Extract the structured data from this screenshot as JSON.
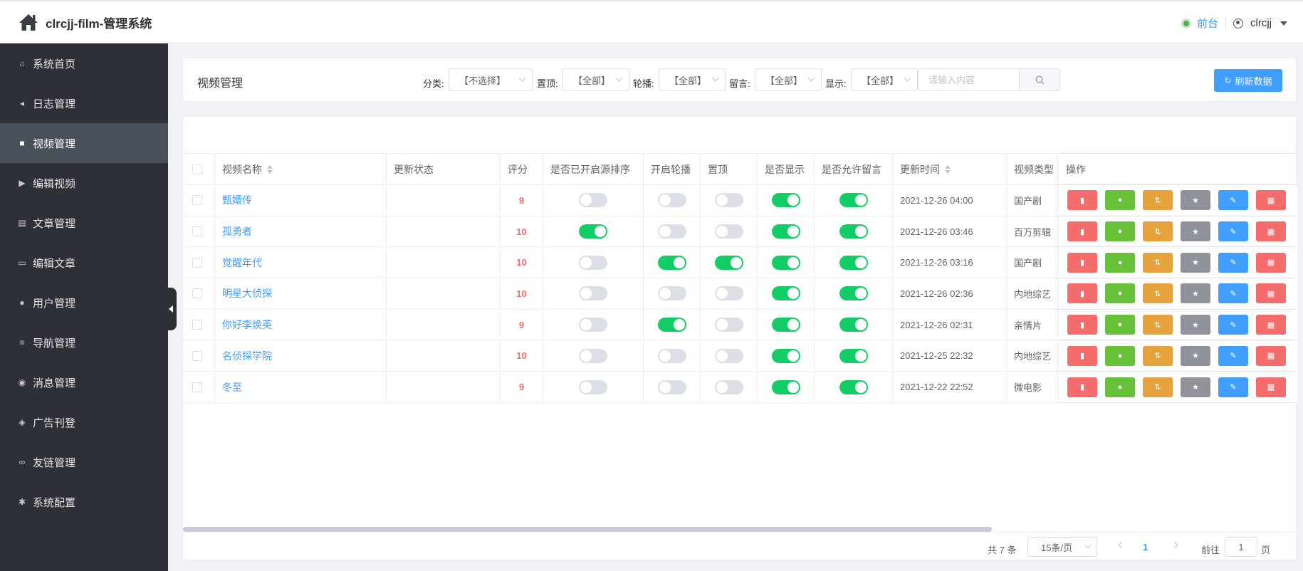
{
  "app": {
    "title": "clrcjj-film-管理系统"
  },
  "header": {
    "front_label": "前台",
    "username": "clrcjj"
  },
  "sidebar": {
    "items": [
      {
        "label": "系统首页",
        "icon": "home-icon",
        "glyph": "⌂"
      },
      {
        "label": "日志管理",
        "icon": "bullhorn-icon",
        "glyph": "◂"
      },
      {
        "label": "视频管理",
        "icon": "video-camera-icon",
        "glyph": "■",
        "active": true
      },
      {
        "label": "编辑视频",
        "icon": "youtube-play-icon",
        "glyph": "▶"
      },
      {
        "label": "文章管理",
        "icon": "file-text-icon",
        "glyph": "▤"
      },
      {
        "label": "编辑文章",
        "icon": "file-outline-icon",
        "glyph": "▭"
      },
      {
        "label": "用户管理",
        "icon": "user-plus-icon",
        "glyph": "●"
      },
      {
        "label": "导航管理",
        "icon": "bars-icon",
        "glyph": "≡"
      },
      {
        "label": "消息管理",
        "icon": "wechat-icon",
        "glyph": "◉"
      },
      {
        "label": "广告刊登",
        "icon": "telegram-icon",
        "glyph": "◈"
      },
      {
        "label": "友链管理",
        "icon": "link-icon",
        "glyph": "∞"
      },
      {
        "label": "系统配置",
        "icon": "gear-icon",
        "glyph": "✱"
      }
    ]
  },
  "filters": {
    "page_title": "视频管理",
    "category_label": "分类:",
    "category_value": "【不选择】",
    "top_label": "置顶:",
    "top_value": "【全部】",
    "carousel_label": "轮播:",
    "carousel_value": "【全部】",
    "comment_label": "留言:",
    "comment_value": "【全部】",
    "show_label": "显示:",
    "show_value": "【全部】",
    "search_placeholder": "请输入内容",
    "refresh_label": "刷新数据"
  },
  "table": {
    "columns": {
      "name": "视频名称",
      "update_status": "更新状态",
      "score": "评分",
      "source_sort": "是否已开启源排序",
      "carousel": "开启轮播",
      "top": "置顶",
      "display": "是否显示",
      "allow_comment": "是否允许留言",
      "update_time": "更新时间",
      "video_type": "视频类型",
      "actions": "操作"
    },
    "rows": [
      {
        "name": "甄嬛传",
        "status": "",
        "score": "9",
        "source_sort": false,
        "carousel": false,
        "top": false,
        "display": true,
        "allow_comment": true,
        "time": "2021-12-26 04:00",
        "type": "国产剧"
      },
      {
        "name": "孤勇者",
        "status": "",
        "score": "10",
        "source_sort": true,
        "carousel": false,
        "top": false,
        "display": true,
        "allow_comment": true,
        "time": "2021-12-26 03:46",
        "type": "百万剪辑"
      },
      {
        "name": "觉醒年代",
        "status": "",
        "score": "10",
        "source_sort": false,
        "carousel": true,
        "top": true,
        "display": true,
        "allow_comment": true,
        "time": "2021-12-26 03:16",
        "type": "国产剧"
      },
      {
        "name": "明星大侦探",
        "status": "",
        "score": "10",
        "source_sort": false,
        "carousel": false,
        "top": false,
        "display": true,
        "allow_comment": true,
        "time": "2021-12-26 02:36",
        "type": "内地综艺"
      },
      {
        "name": "你好李焕英",
        "status": "",
        "score": "9",
        "source_sort": false,
        "carousel": true,
        "top": false,
        "display": true,
        "allow_comment": true,
        "time": "2021-12-26 02:31",
        "type": "亲情片"
      },
      {
        "name": "名侦探学院",
        "status": "",
        "score": "10",
        "source_sort": false,
        "carousel": false,
        "top": false,
        "display": true,
        "allow_comment": true,
        "time": "2021-12-25 22:32",
        "type": "内地综艺"
      },
      {
        "name": "冬至",
        "status": "",
        "score": "9",
        "source_sort": false,
        "carousel": false,
        "top": false,
        "display": true,
        "allow_comment": true,
        "time": "2021-12-22 22:52",
        "type": "微电影"
      }
    ],
    "action_buttons": [
      {
        "name": "document-icon",
        "color": "#f56c6c"
      },
      {
        "name": "record-icon",
        "color": "#67c23a"
      },
      {
        "name": "sort-icon",
        "color": "#e6a23c"
      },
      {
        "name": "star-icon",
        "color": "#909399"
      },
      {
        "name": "pencil-icon",
        "color": "#409eff"
      },
      {
        "name": "trash-icon",
        "color": "#f56c6c"
      }
    ]
  },
  "pagination": {
    "total": "共 7 条",
    "page_size": "15条/页",
    "current_page": "1",
    "goto_label": "前往",
    "goto_value": "1",
    "page_suffix": "页"
  },
  "colors": {
    "primary": "#409eff",
    "sidebar_bg": "#2d3037",
    "switch_on": "#13ce66",
    "score": "#f56c6c"
  }
}
